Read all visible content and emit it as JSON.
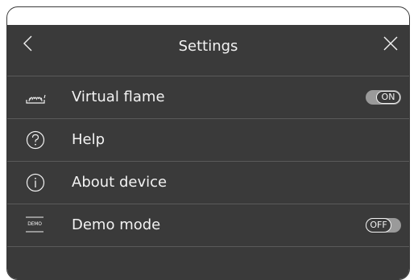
{
  "header": {
    "title": "Settings",
    "back_icon": "chevron-left-icon",
    "close_icon": "close-icon"
  },
  "items": [
    {
      "label": "Virtual flame",
      "icon": "flame-icon",
      "toggle": {
        "state": "ON"
      }
    },
    {
      "label": "Help",
      "icon": "help-icon"
    },
    {
      "label": "About device",
      "icon": "info-icon"
    },
    {
      "label": "Demo mode",
      "icon": "demo-icon",
      "icon_text": "DEMO",
      "toggle": {
        "state": "OFF"
      }
    }
  ],
  "colors": {
    "background": "#3a3a3a",
    "text": "#f2f2f2",
    "divider": "#5a5a5a",
    "toggle_track": "#9a9a9a"
  }
}
